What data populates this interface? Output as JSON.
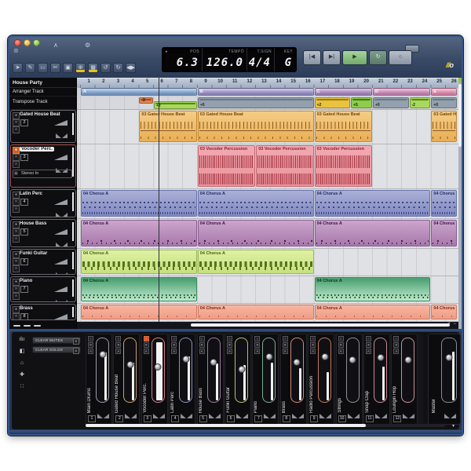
{
  "window": {
    "logo_slashes": "///",
    "logo_o": "o"
  },
  "project": {
    "name": "House Party"
  },
  "toolbar": {
    "tools": [
      {
        "name": "select-tool",
        "glyph": "➤",
        "active": false
      },
      {
        "name": "draw-tool",
        "glyph": "✎",
        "active": false
      },
      {
        "name": "erase-tool",
        "glyph": "▭",
        "active": false
      },
      {
        "name": "split-tool",
        "glyph": "✂",
        "active": false
      },
      {
        "name": "mute-tool",
        "glyph": "▣",
        "active": false
      },
      {
        "name": "zoom-tool",
        "glyph": "⊕",
        "active": true
      },
      {
        "name": "grid-tool",
        "glyph": "▦",
        "active": true
      },
      {
        "name": "undo-button",
        "glyph": "↺",
        "active": false
      },
      {
        "name": "redo-button",
        "glyph": "↻",
        "active": false
      },
      {
        "name": "io-button",
        "glyph": "◀▶",
        "active": false
      }
    ],
    "upper": [
      {
        "name": "tuner-icon",
        "glyph": "∧"
      },
      {
        "name": "setup-icon",
        "glyph": "⚙"
      }
    ]
  },
  "transport": {
    "pos_label": "POS",
    "pos_arrow": "▸",
    "pos_value": "6.3",
    "tempo_label": "TEMPO",
    "tempo_value": "126.0",
    "tsign_label": "T.SIGN",
    "tsign_value": "4/4",
    "key_label": "KEY",
    "key_value": "G",
    "buttons": [
      {
        "name": "rewind-button",
        "glyph": "|◀"
      },
      {
        "name": "forward-button",
        "glyph": "▶|"
      },
      {
        "name": "play-button",
        "glyph": "▶"
      },
      {
        "name": "cycle-button",
        "glyph": "↻"
      },
      {
        "name": "record-button",
        "glyph": "○"
      }
    ]
  },
  "tracks_panel": {
    "arranger_label": "Arranger Track",
    "transpose_label": "Transpose Track",
    "mute_glyph": "✕",
    "auto_glyph": "A",
    "rec_glyph": "●",
    "tracks": [
      {
        "num": "2",
        "name": "Gated House Beat",
        "style": "drums",
        "selected": false
      },
      {
        "num": "3",
        "name": "Vocoder Perc.",
        "style": "vocoder",
        "selected": true,
        "input": "Stereo In"
      },
      {
        "num": "4",
        "name": "Latin Perc",
        "style": "latin",
        "selected": false
      },
      {
        "num": "5",
        "name": "House Bass",
        "style": "bass",
        "selected": false
      },
      {
        "num": "6",
        "name": "Funki Guitar",
        "style": "guitar",
        "selected": false
      },
      {
        "num": "7",
        "name": "Piano",
        "style": "piano",
        "selected": false
      },
      {
        "num": "8",
        "name": "Brass",
        "style": "brass",
        "selected": false
      }
    ]
  },
  "ruler": {
    "bars": [
      1,
      2,
      3,
      4,
      5,
      6,
      7,
      8,
      9,
      10,
      11,
      12,
      13,
      14,
      15,
      16,
      17,
      18,
      19,
      20,
      21,
      22,
      23,
      24,
      25,
      26
    ]
  },
  "playhead": {
    "bar": 6.3
  },
  "arranger_sections": [
    {
      "label": "A",
      "start": 1,
      "end": 9,
      "color": "#6f96c6"
    },
    {
      "label": "B",
      "start": 9,
      "end": 17,
      "color": "#8a82be"
    },
    {
      "label": "C",
      "start": 17,
      "end": 21,
      "color": "#9d79b4"
    },
    {
      "label": "D",
      "start": 21,
      "end": 25,
      "color": "#c277ac"
    },
    {
      "label": "E",
      "start": 25,
      "end": 27.3,
      "color": "#d878a2"
    }
  ],
  "transpose_clips": [
    {
      "label": "-3",
      "start": 5,
      "end": 6,
      "color": "#e2854e",
      "accent": "#b5421e",
      "pos": "top"
    },
    {
      "label": "+2",
      "start": 6,
      "end": 9,
      "color": "#a8d85c",
      "accent": "#4e8a1a",
      "pos": "low"
    },
    {
      "label": "+0",
      "start": 9,
      "end": 17,
      "color": "#93a0ad",
      "accent": "#6a7a88",
      "pos": "full"
    },
    {
      "label": "+2",
      "start": 17,
      "end": 19.5,
      "color": "#e9c23e",
      "accent": "#9a7a10",
      "pos": "full"
    },
    {
      "label": "+5",
      "start": 19.5,
      "end": 21,
      "color": "#8ecc4a",
      "accent": "#3f7a12",
      "pos": "full"
    },
    {
      "label": "+0",
      "start": 21,
      "end": 23.5,
      "color": "#93a0ad",
      "accent": "#6a7a88",
      "pos": "full"
    },
    {
      "label": "-2",
      "start": 23.5,
      "end": 25,
      "color": "#a8d85c",
      "accent": "#4e8a1a",
      "pos": "full"
    },
    {
      "label": "+0",
      "start": 25,
      "end": 27.3,
      "color": "#93a0ad",
      "accent": "#6a7a88",
      "pos": "full"
    }
  ],
  "lanes": [
    {
      "style": "drums",
      "clips": [
        {
          "label": "03 Gated House Beat",
          "start": 5,
          "end": 9
        },
        {
          "label": "03 Gated House Beat",
          "start": 9,
          "end": 17
        },
        {
          "label": "03 Gated House Beat",
          "start": 17,
          "end": 21
        },
        {
          "label": "03 Gated House Beat",
          "start": 25,
          "end": 27.3
        }
      ]
    },
    {
      "style": "vocoder",
      "clips": [
        {
          "label": "03 Vocoder Percussion",
          "start": 9,
          "end": 13
        },
        {
          "label": "03 Vocoder Percussion",
          "start": 13,
          "end": 17
        },
        {
          "label": "03 Vocoder Percussion",
          "start": 17,
          "end": 21
        }
      ]
    },
    {
      "style": "latin",
      "clips": [
        {
          "label": "04 Chorus A",
          "start": 1,
          "end": 9
        },
        {
          "label": "04 Chorus A",
          "start": 9,
          "end": 17
        },
        {
          "label": "04 Chorus A",
          "start": 17,
          "end": 25
        },
        {
          "label": "04 Chorus A",
          "start": 25,
          "end": 27.3
        }
      ]
    },
    {
      "style": "bass",
      "clips": [
        {
          "label": "04 Chorus A",
          "start": 1,
          "end": 9
        },
        {
          "label": "04 Chorus A",
          "start": 9,
          "end": 17
        },
        {
          "label": "04 Chorus A",
          "start": 17,
          "end": 25
        },
        {
          "label": "04 Chorus A",
          "start": 25,
          "end": 27.3
        }
      ]
    },
    {
      "style": "guitar",
      "clips": [
        {
          "label": "04 Chorus A",
          "start": 1,
          "end": 9
        },
        {
          "label": "04 Chorus A",
          "start": 9,
          "end": 17
        }
      ]
    },
    {
      "style": "piano",
      "clips": [
        {
          "label": "04 Chorus A",
          "start": 1,
          "end": 9
        },
        {
          "label": "04 Chorus A",
          "start": 17,
          "end": 25
        }
      ]
    },
    {
      "style": "brass",
      "clips": [
        {
          "label": "04 Chorus A",
          "start": 1,
          "end": 9
        },
        {
          "label": "04 Chorus A",
          "start": 9,
          "end": 17
        },
        {
          "label": "04 Chorus A",
          "start": 17,
          "end": 25
        },
        {
          "label": "04 Chorus A",
          "start": 25,
          "end": 27.3
        }
      ]
    }
  ],
  "mixer": {
    "clear_mutes_label": "CLEAR MUTES",
    "clear_solos_label": "CLEAR SOLOS",
    "mute_glyph": "✕",
    "solo_glyph": "A",
    "channel_buttons": [
      "○",
      "✕",
      "A"
    ],
    "left_icons": [
      {
        "name": "mixer-icon",
        "glyph": "ılıı"
      },
      {
        "name": "monitor-icon",
        "glyph": "◧"
      },
      {
        "name": "home-icon",
        "glyph": "⌂"
      },
      {
        "name": "navigate-icon",
        "glyph": "✚"
      },
      {
        "name": "pattern-icon",
        "glyph": "∷"
      }
    ],
    "channels": [
      {
        "num": "1",
        "name": "Main Drums",
        "color": "#9a9aa2",
        "fader": 0.2,
        "meter": 0.78,
        "armed": false,
        "selected": false
      },
      {
        "num": "2",
        "name": "Gated House Beat",
        "color": "#c8a060",
        "fader": 0.38,
        "meter": 0.62,
        "armed": false,
        "selected": false
      },
      {
        "num": "3",
        "name": "Vocoder Perc.",
        "color": "#d08088",
        "fader": 0.42,
        "meter": 0.95,
        "armed": true,
        "selected": true
      },
      {
        "num": "4",
        "name": "Latin Perc",
        "color": "#8a92bc",
        "fader": 0.28,
        "meter": 0.72,
        "armed": false,
        "selected": false
      },
      {
        "num": "5",
        "name": "House Bass",
        "color": "#a27aa6",
        "fader": 0.34,
        "meter": 0.6,
        "armed": false,
        "selected": false
      },
      {
        "num": "6",
        "name": "Funki Guitar",
        "color": "#b2c468",
        "fader": 0.46,
        "meter": 0.58,
        "armed": false,
        "selected": false
      },
      {
        "num": "7",
        "name": "Piano",
        "color": "#7aae8e",
        "fader": 0.24,
        "meter": 0.62,
        "armed": false,
        "selected": false
      },
      {
        "num": "8",
        "name": "Brass",
        "color": "#d08a78",
        "fader": 0.34,
        "meter": 0.52,
        "armed": false,
        "selected": false
      },
      {
        "num": "9",
        "name": "Radio Percussion",
        "color": "#c87a58",
        "fader": 0.24,
        "meter": 0.46,
        "armed": false,
        "selected": false
      },
      {
        "num": "10",
        "name": "Strings",
        "color": "#909098",
        "fader": 0.3,
        "meter": 0.0,
        "armed": false,
        "selected": false
      },
      {
        "num": "11",
        "name": "Snap Clap",
        "color": "#c88a92",
        "fader": 0.26,
        "meter": 0.55,
        "armed": false,
        "selected": false
      },
      {
        "num": "12",
        "name": "Loungin Hop",
        "color": "#c89298",
        "fader": 0.3,
        "meter": 0.0,
        "armed": false,
        "selected": false
      }
    ],
    "master": {
      "name": "Master",
      "fader": 0.26,
      "meter": 0.8
    }
  }
}
